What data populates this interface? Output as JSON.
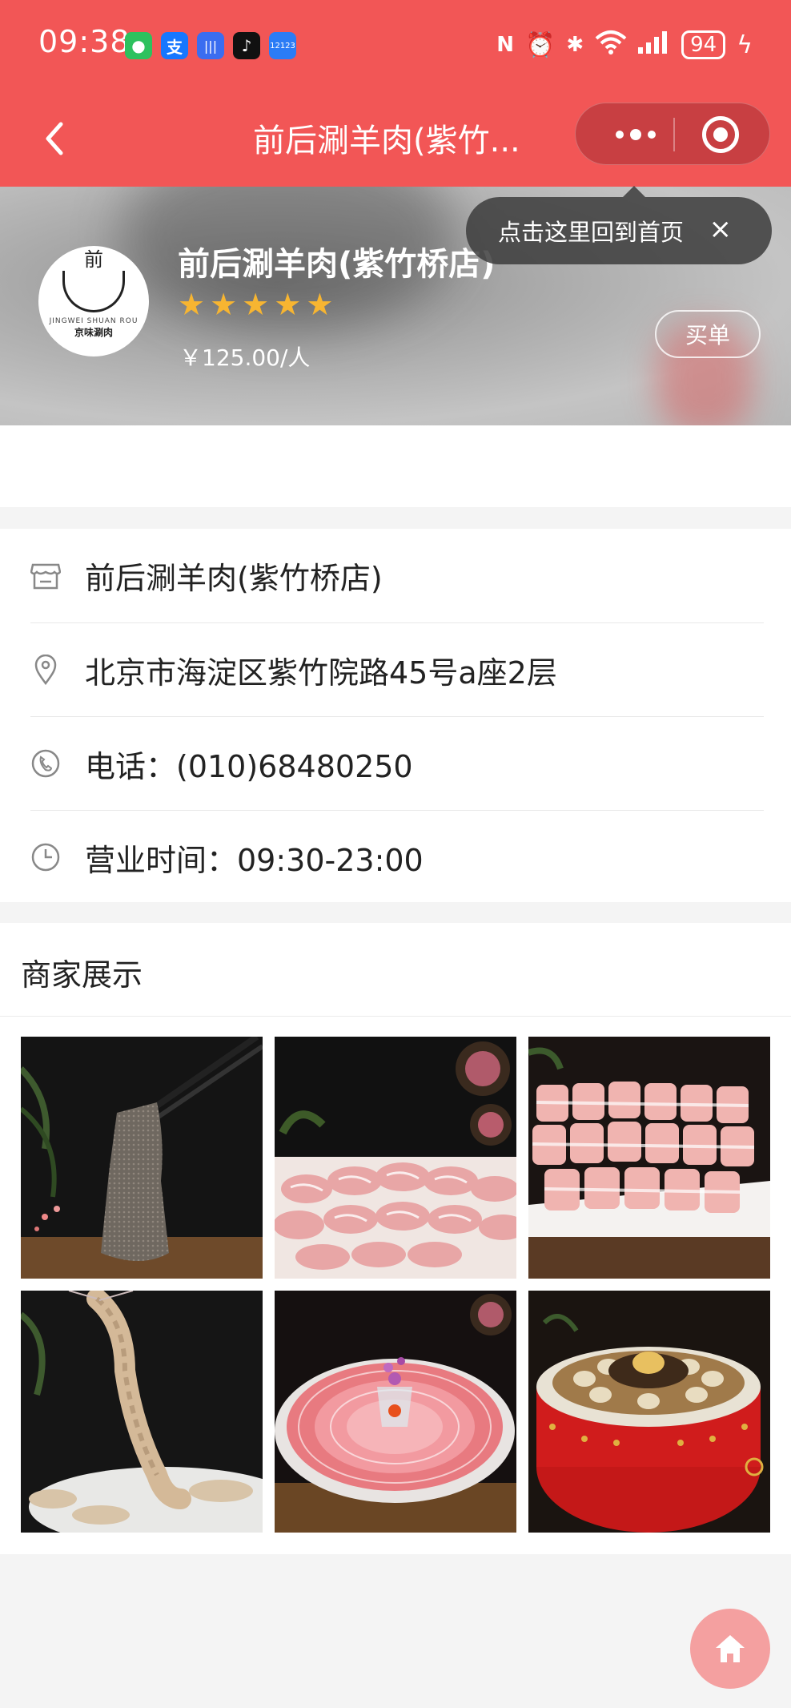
{
  "status_bar": {
    "time": "09:38",
    "battery": "94",
    "apps": [
      "wechat-icon",
      "alipay-icon",
      "voice-icon",
      "tiktok-icon",
      "12123-icon"
    ],
    "indicators": [
      "nfc-icon",
      "alarm-icon",
      "bluetooth-icon",
      "wifi-icon",
      "signal-icon",
      "charging-icon"
    ]
  },
  "nav": {
    "title": "前后涮羊肉(紫竹...",
    "bar_color": "#f25656"
  },
  "header": {
    "shop_name": "前后涮羊肉(紫竹桥店)",
    "rating": 5,
    "price": "￥125.00/人",
    "pay_button": "买单",
    "star_color": "#f7b531"
  },
  "tooltip": {
    "text": "点击这里回到首页",
    "close": "×"
  },
  "info": {
    "name": "前后涮羊肉(紫竹桥店)",
    "address": "北京市海淀区紫竹院路45号a座2层",
    "phone": "电话：(010)68480250",
    "hours": "营业时间：09:30-23:00"
  },
  "showcase": {
    "title": "商家展示",
    "photos": [
      "tripe-photo",
      "lamb-slices-photo",
      "lamb-rolls-photo",
      "shrimp-photo",
      "lamb-platter-photo",
      "mushroom-hotpot-photo"
    ]
  },
  "home_button": "home-icon"
}
